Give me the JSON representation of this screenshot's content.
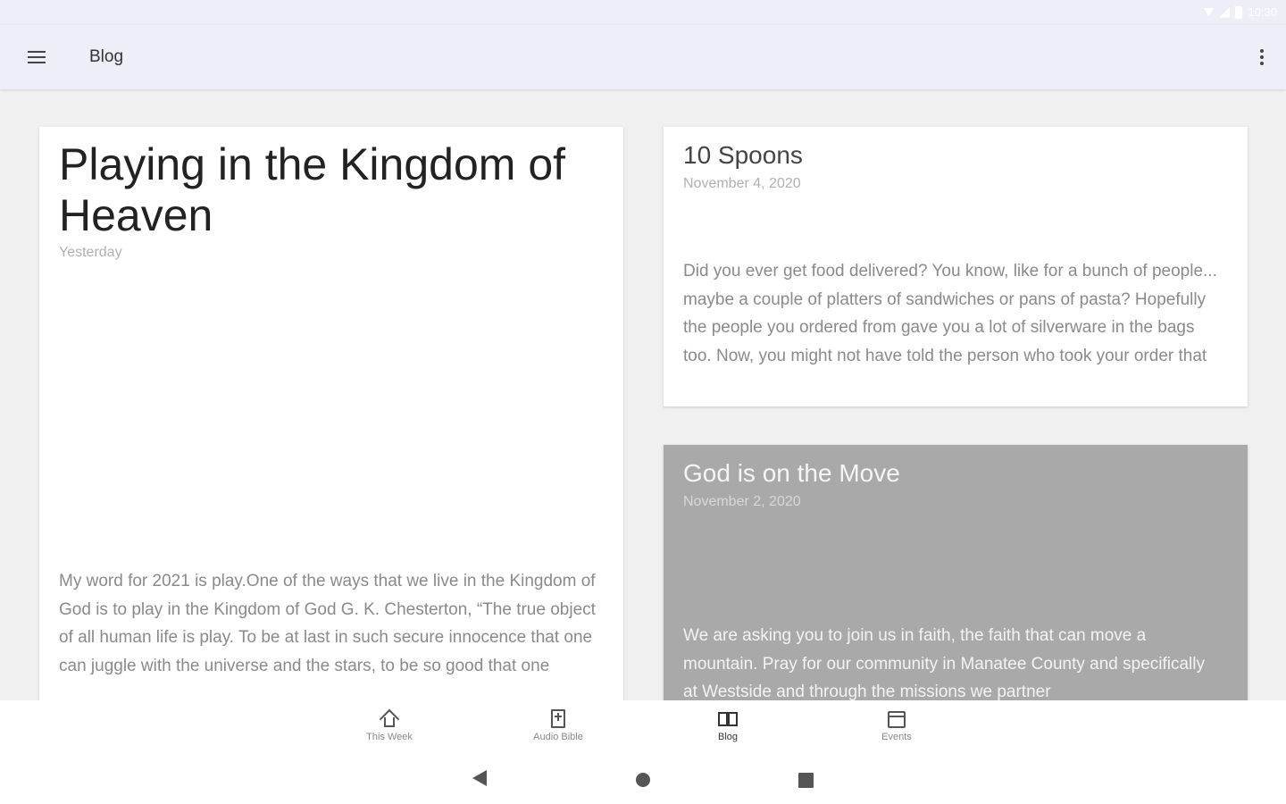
{
  "status_bar": {
    "time": "10:30",
    "icons": [
      "wifi-icon",
      "signal-icon",
      "battery-icon"
    ]
  },
  "app_bar": {
    "title": "Blog",
    "menu_icon": "menu-icon",
    "overflow_icon": "more-vert-icon"
  },
  "posts": [
    {
      "title": "Playing in the Kingdom of Heaven",
      "date": "Yesterday",
      "excerpt": "My word for 2021 is play.One of the ways that we live in the Kingdom of God is to play in the Kingdom of God G. K. Chesterton, “The true object of all human life is play.  To be at last in such secure innocence that one can juggle with the universe and the stars, to be so good that one"
    },
    {
      "title": "10 Spoons",
      "date": "November 4, 2020",
      "excerpt": "Did you ever get food delivered?  You know, like for a bunch of people... maybe a couple of platters of sandwiches or pans of pasta?  Hopefully the people you ordered from gave you a lot of silverware in the bags too.  Now, you might not have told the person who took your order that"
    },
    {
      "title": "God is on the Move",
      "date": "November 2, 2020",
      "excerpt": "We are asking you to join us in faith, the faith that can move a mountain. Pray for our community in Manatee County and specifically at Westside and through the missions we partner"
    }
  ],
  "bottom_nav": {
    "items": [
      {
        "label": "This Week",
        "icon": "home-icon",
        "active": false
      },
      {
        "label": "Audio Bible",
        "icon": "bible-icon",
        "active": false
      },
      {
        "label": "Blog",
        "icon": "blog-icon",
        "active": true
      },
      {
        "label": "Events",
        "icon": "calendar-icon",
        "active": false
      }
    ]
  },
  "system_nav": {
    "buttons": [
      "back-icon",
      "home-circle-icon",
      "recents-icon"
    ]
  },
  "colors": {
    "app_bar_bg": "#eeeef8",
    "page_bg": "#f0f0f0",
    "card_bg": "#ffffff",
    "image_card_bg": "#a9a9a9",
    "active_nav": "#333333",
    "inactive_nav": "#888888"
  }
}
